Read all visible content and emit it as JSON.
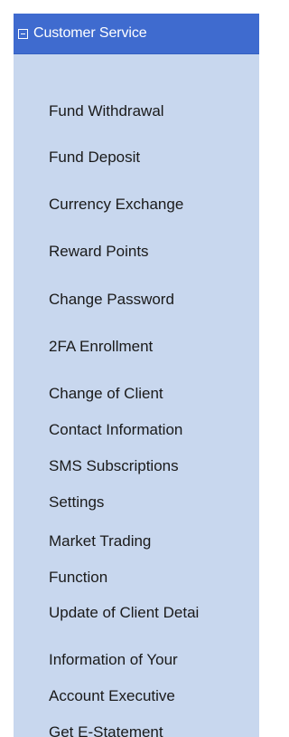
{
  "menu": {
    "header_label": "Customer Service",
    "collapse_icon": "collapse-minus-icon",
    "colors": {
      "header_bg": "#3f6bcf",
      "list_bg": "#c8d7ee",
      "header_text": "#ffffff",
      "item_text": "#1a1a1a"
    },
    "items": [
      {
        "lines": [
          "Fund Withdrawal"
        ]
      },
      {
        "lines": [
          "Fund Deposit"
        ]
      },
      {
        "lines": [
          "Currency Exchange"
        ]
      },
      {
        "lines": [
          "Reward Points"
        ]
      },
      {
        "lines": [
          "Change Password"
        ]
      },
      {
        "lines": [
          "2FA Enrollment"
        ]
      },
      {
        "lines": [
          "Change of Client",
          "Contact Information"
        ]
      },
      {
        "lines": [
          "SMS Subscriptions",
          "Settings"
        ]
      },
      {
        "lines": [
          "Market Trading",
          "Function"
        ]
      },
      {
        "lines": [
          "Update of Client Detai"
        ]
      },
      {
        "lines": [
          "Information of Your",
          "Account Executive"
        ]
      },
      {
        "lines": [
          "Get E-Statement"
        ]
      }
    ]
  }
}
